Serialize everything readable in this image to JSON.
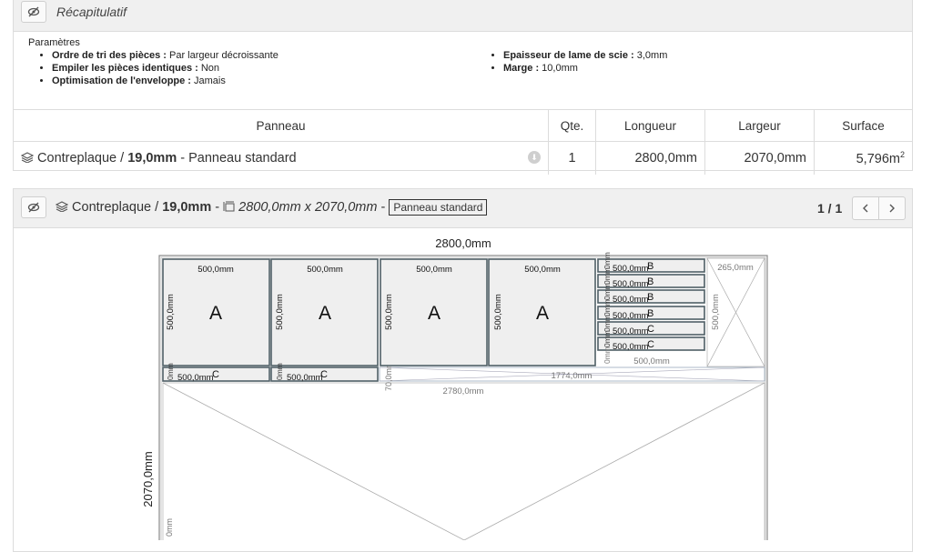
{
  "summary": {
    "title": "Récapitulatif",
    "params_heading": "Paramètres",
    "params_left": [
      {
        "label": "Ordre de tri des pièces :",
        "value": " Par largeur décroissante"
      },
      {
        "label": "Empiler les pièces identiques :",
        "value": " Non"
      },
      {
        "label": "Optimisation de l'enveloppe :",
        "value": " Jamais"
      }
    ],
    "params_right": [
      {
        "label": "Epaisseur de lame de scie :",
        "value": " 3,0mm"
      },
      {
        "label": "Marge :",
        "value": " 10,0mm"
      }
    ],
    "columns": [
      "Panneau",
      "Qte.",
      "Longueur",
      "Largeur",
      "Surface"
    ],
    "row": {
      "material": "Contreplaque",
      "sep": " / ",
      "thickness": "19,0mm",
      "dash": " - ",
      "panel_type": "Panneau standard",
      "qty": "1",
      "length": "2800,0mm",
      "width": "2070,0mm",
      "surface": "5,796m",
      "surface_exp": "2"
    }
  },
  "board": {
    "material": "Contreplaque",
    "sep": " / ",
    "thickness": "19,0mm",
    "dash1": " - ",
    "dims": "2800,0mm x 2070,0mm",
    "dash2": " - ",
    "badge": "Panneau standard",
    "pager": "1 / 1",
    "prev_icon": "chevron-left-icon",
    "next_icon": "chevron-right-icon"
  },
  "diagram": {
    "top_dim": "2800,0mm",
    "side_dim": "2070,0mm",
    "piece_w": "500,0mm",
    "piece_h": "500,0mm",
    "label_a": "A",
    "label_b": "B",
    "label_c": "C",
    "zero": "0mm",
    "w265": "265,0mm",
    "w1774": "1774,0mm",
    "w2780": "2780,0mm",
    "h70": "70,0mm"
  }
}
